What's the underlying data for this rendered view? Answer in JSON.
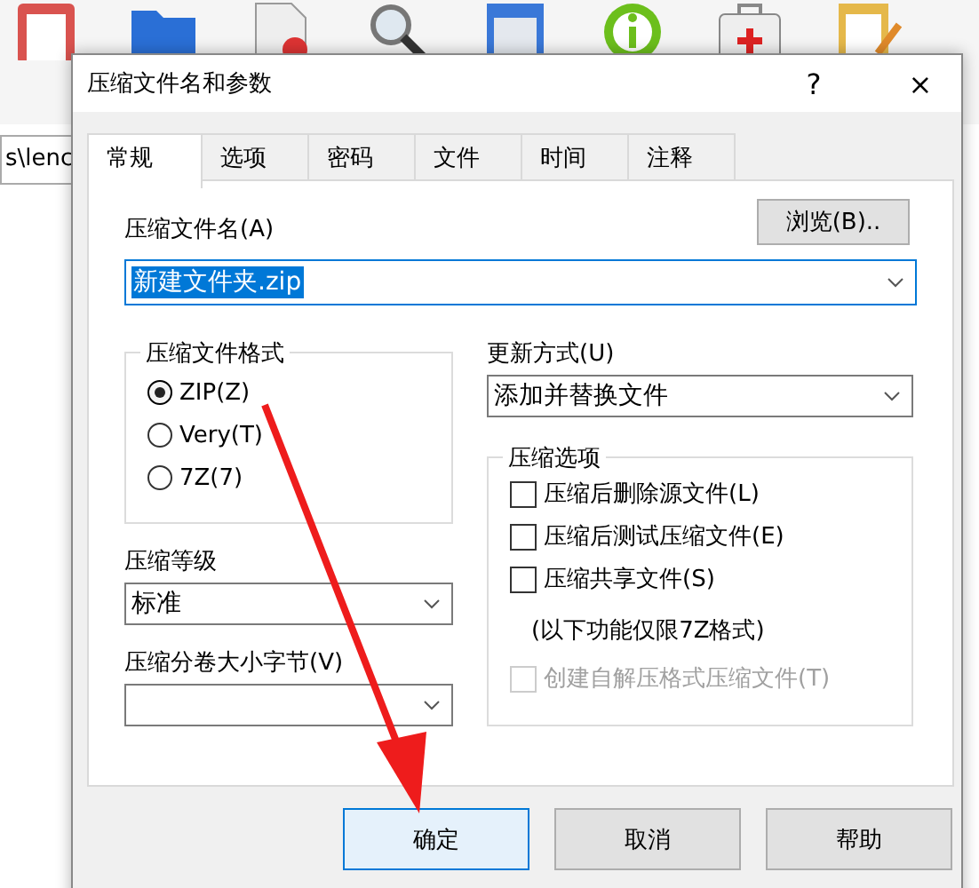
{
  "address_bar": {
    "value": "s\\lenc"
  },
  "dialog": {
    "title": "压缩文件名和参数",
    "help": "?",
    "close": "×",
    "tabs": [
      {
        "label": "常规",
        "selected": true
      },
      {
        "label": "选项",
        "selected": false
      },
      {
        "label": "密码",
        "selected": false
      },
      {
        "label": "文件",
        "selected": false
      },
      {
        "label": "时间",
        "selected": false
      },
      {
        "label": "注释",
        "selected": false
      }
    ],
    "archive_name": {
      "label": "压缩文件名(A)",
      "value": "新建文件夹.zip",
      "text_selected": true,
      "browse": "浏览(B).."
    },
    "format_group": {
      "title": "压缩文件格式",
      "options": [
        {
          "label": "ZIP(Z)",
          "selected": true
        },
        {
          "label": "Very(T)",
          "selected": false
        },
        {
          "label": "7Z(7)",
          "selected": false
        }
      ]
    },
    "level": {
      "label": "压缩等级",
      "value": "标准"
    },
    "split": {
      "label": "压缩分卷大小字节(V)"
    },
    "update_mode": {
      "label": "更新方式(U)",
      "value": "添加并替换文件"
    },
    "options_group": {
      "title": "压缩选项",
      "items": [
        {
          "kind": "checkbox",
          "label": "压缩后删除源文件(L)",
          "checked": false,
          "disabled": false
        },
        {
          "kind": "checkbox",
          "label": "压缩后测试压缩文件(E)",
          "checked": false,
          "disabled": false
        },
        {
          "kind": "checkbox",
          "label": "压缩共享文件(S)",
          "checked": false,
          "disabled": false
        },
        {
          "kind": "note",
          "label": "(以下功能仅限7Z格式)"
        },
        {
          "kind": "checkbox",
          "label": "创建自解压格式压缩文件(T)",
          "checked": false,
          "disabled": true
        }
      ]
    },
    "buttons": [
      {
        "label": "确定",
        "default": true
      },
      {
        "label": "取消",
        "default": false
      },
      {
        "label": "帮助",
        "default": false
      }
    ]
  }
}
